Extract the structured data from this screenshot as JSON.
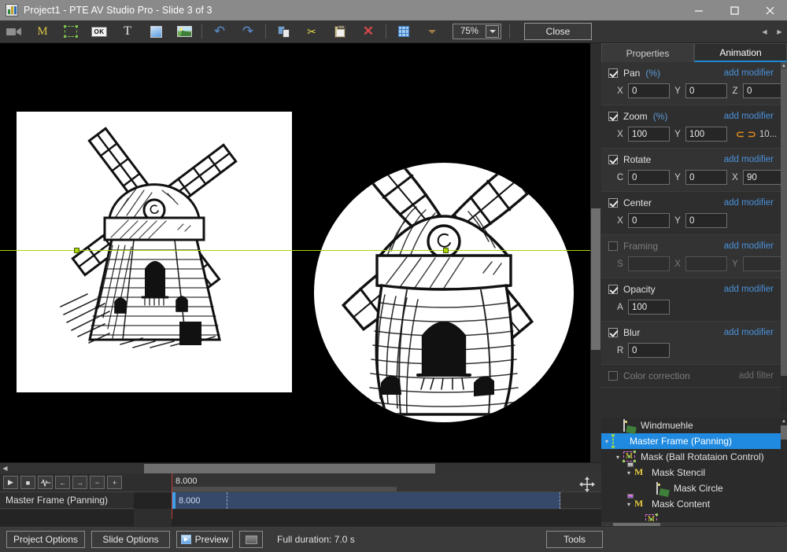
{
  "window": {
    "title": "Project1 - PTE AV Studio Pro - Slide 3 of 3",
    "app_icon": "app-logo-icon",
    "minimize": "–",
    "maximize": "▫",
    "close": "✕"
  },
  "toolbar": {
    "items": [
      {
        "name": "video-camera-icon",
        "glyph": "📹"
      },
      {
        "name": "mask-m-icon",
        "glyph": "M"
      },
      {
        "name": "frame-icon",
        "glyph": ""
      },
      {
        "name": "button-ok-icon",
        "glyph": "OK"
      },
      {
        "name": "text-icon",
        "glyph": "T"
      },
      {
        "name": "rectangle-icon",
        "glyph": ""
      },
      {
        "name": "image-icon",
        "glyph": ""
      },
      {
        "name": "undo-icon",
        "glyph": "↶"
      },
      {
        "name": "redo-icon",
        "glyph": "↷"
      },
      {
        "name": "copy-icon",
        "glyph": ""
      },
      {
        "name": "cut-scissors-icon",
        "glyph": "✂"
      },
      {
        "name": "paste-icon",
        "glyph": ""
      },
      {
        "name": "delete-icon",
        "glyph": "✕"
      },
      {
        "name": "grid-icon",
        "glyph": ""
      }
    ],
    "zoom_value": "75%",
    "close_label": "Close"
  },
  "panel": {
    "tabs": [
      {
        "label": "Properties",
        "active": false
      },
      {
        "label": "Animation",
        "active": true
      }
    ],
    "nav_prev": "◀",
    "nav_next": "▶",
    "add_modifier_label": "add modifier",
    "add_filter_label": "add filter",
    "rows": [
      {
        "name": "pan",
        "label": "Pan",
        "unit": "(%)",
        "enabled": true,
        "fields": [
          {
            "label": "X",
            "value": "0"
          },
          {
            "label": "Y",
            "value": "0"
          },
          {
            "label": "Z",
            "value": "0"
          }
        ]
      },
      {
        "name": "zoom",
        "label": "Zoom",
        "unit": "(%)",
        "enabled": true,
        "fields": [
          {
            "label": "X",
            "value": "100"
          },
          {
            "label": "Y",
            "value": "100"
          }
        ],
        "extra_arrow_left": "⊂",
        "extra_arrow_right": "⊃",
        "extra_text": "10..."
      },
      {
        "name": "rotate",
        "label": "Rotate",
        "unit": "",
        "enabled": true,
        "fields": [
          {
            "label": "C",
            "value": "0"
          },
          {
            "label": "Y",
            "value": "0"
          },
          {
            "label": "X",
            "value": "90"
          }
        ]
      },
      {
        "name": "center",
        "label": "Center",
        "unit": "",
        "enabled": true,
        "fields": [
          {
            "label": "X",
            "value": "0"
          },
          {
            "label": "Y",
            "value": "0"
          }
        ]
      },
      {
        "name": "framing",
        "label": "Framing",
        "unit": "",
        "enabled": false,
        "fields": [
          {
            "label": "S",
            "value": ""
          },
          {
            "label": "X",
            "value": ""
          },
          {
            "label": "Y",
            "value": ""
          }
        ]
      },
      {
        "name": "opacity",
        "label": "Opacity",
        "unit": "",
        "enabled": true,
        "fields": [
          {
            "label": "A",
            "value": "100"
          }
        ]
      },
      {
        "name": "blur",
        "label": "Blur",
        "unit": "",
        "enabled": true,
        "fields": [
          {
            "label": "R",
            "value": "0"
          }
        ]
      }
    ],
    "color_correction": {
      "label": "Color correction",
      "enabled": false,
      "action": "add filter"
    }
  },
  "tree": {
    "nodes": [
      {
        "label": "Windmuehle",
        "icon": "image-icon",
        "indent": 1,
        "twisty": "",
        "selected": false
      },
      {
        "label": "Master Frame (Panning)",
        "icon": "frame-icon",
        "indent": 0,
        "twisty": "▾",
        "selected": true
      },
      {
        "label": "Mask (Ball Rotataion Control)",
        "icon": "mask-box-icon",
        "indent": 1,
        "twisty": "▾",
        "selected": false
      },
      {
        "label": "Mask Stencil",
        "icon": "mask-stencil-icon",
        "indent": 2,
        "twisty": "▾",
        "selected": false
      },
      {
        "label": "Mask Circle",
        "icon": "image-icon",
        "indent": 3,
        "twisty": "",
        "selected": false
      },
      {
        "label": "Mask Content",
        "icon": "mask-content-icon",
        "indent": 2,
        "twisty": "▾",
        "selected": false
      }
    ]
  },
  "timeline": {
    "buttons": [
      {
        "name": "play-button",
        "glyph": "▶"
      },
      {
        "name": "stop-button",
        "glyph": "■"
      },
      {
        "name": "waveform-button",
        "glyph": "⌇"
      },
      {
        "name": "prev-keyframe-button",
        "glyph": "←"
      },
      {
        "name": "next-keyframe-button",
        "glyph": "→"
      },
      {
        "name": "zoom-out-button",
        "glyph": "−"
      },
      {
        "name": "zoom-in-button",
        "glyph": "+"
      }
    ],
    "ruler_value": "8.000",
    "track_name": "Master Frame (Panning)",
    "clip_value": "8.000",
    "move-cursor": "move-cursor-icon"
  },
  "statusbar": {
    "project_options": "Project Options",
    "slide_options": "Slide Options",
    "preview": "Preview",
    "tools": "Tools",
    "duration": "Full duration: 7.0 s"
  },
  "canvas": {
    "left_slide_alt": "windmill-line-drawing",
    "circle_mask_alt": "windmill-spherical-mask"
  }
}
